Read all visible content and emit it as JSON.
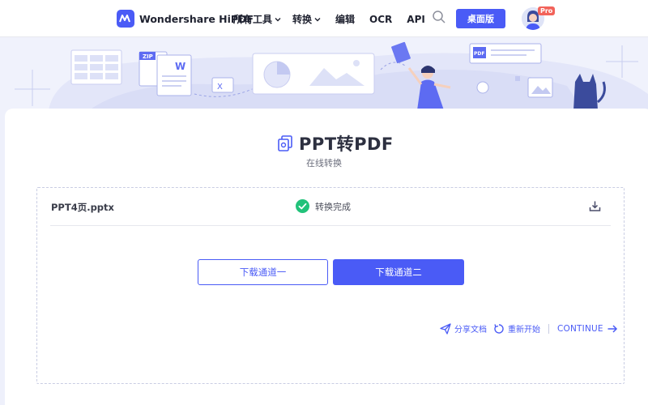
{
  "header": {
    "brand": "Wondershare HiPDF",
    "nav": [
      {
        "label": "所有工具"
      },
      {
        "label": "转换"
      },
      {
        "label": "编辑"
      },
      {
        "label": "OCR"
      },
      {
        "label": "API"
      }
    ],
    "desktop_button": "桌面版",
    "pro_badge": "Pro"
  },
  "banner": {
    "zip_label": "ZIP",
    "word_label": "W",
    "excel_label": "X",
    "pdf_label": "PDF"
  },
  "main": {
    "title": "PPT转PDF",
    "subtitle": "在线转换",
    "file": {
      "name": "PPT4页.pptx",
      "status": "转换完成"
    },
    "download_btn_1": "下载通道一",
    "download_btn_2": "下载通道二",
    "share": "分享文档",
    "restart": "重新开始",
    "continue": "CONTINUE"
  },
  "colors": {
    "accent": "#4a5bf6",
    "success": "#22c27a",
    "badge": "#f2635a"
  }
}
